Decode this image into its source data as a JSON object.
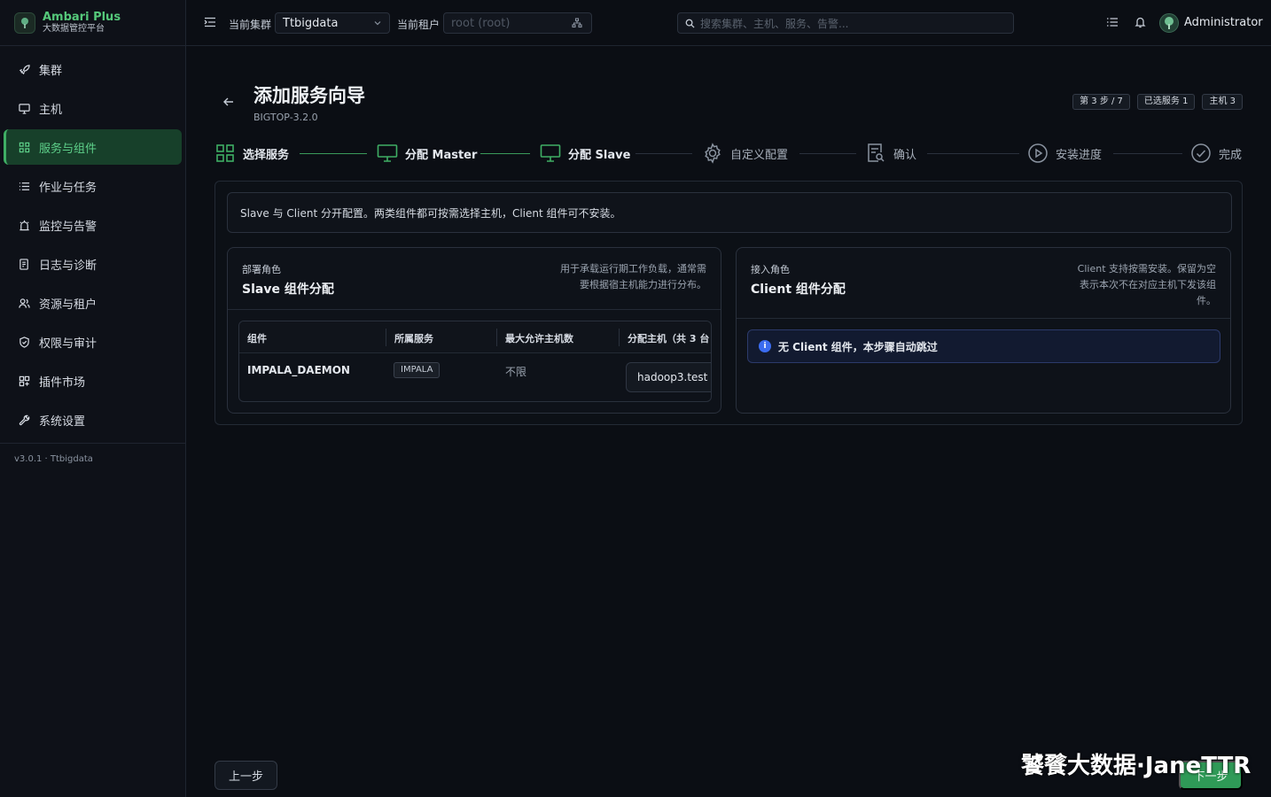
{
  "brand": {
    "name": "Ambari Plus",
    "subtitle": "大数据管控平台",
    "logo_icon": "tree-icon"
  },
  "sidebar": {
    "items": [
      {
        "label": "集群",
        "icon": "rocket-icon",
        "active": false
      },
      {
        "label": "主机",
        "icon": "monitor-icon",
        "active": false
      },
      {
        "label": "服务与组件",
        "icon": "grid-icon",
        "active": true
      },
      {
        "label": "作业与任务",
        "icon": "list-icon",
        "active": false
      },
      {
        "label": "监控与告警",
        "icon": "alarm-icon",
        "active": false
      },
      {
        "label": "日志与诊断",
        "icon": "log-icon",
        "active": false
      },
      {
        "label": "资源与租户",
        "icon": "users-icon",
        "active": false
      },
      {
        "label": "权限与审计",
        "icon": "shield-icon",
        "active": false
      },
      {
        "label": "插件市场",
        "icon": "plugin-icon",
        "active": false
      },
      {
        "label": "系统设置",
        "icon": "wrench-icon",
        "active": false
      }
    ],
    "footer": "v3.0.1 · Ttbigdata"
  },
  "topbar": {
    "cluster_label": "当前集群",
    "cluster_value": "Ttbigdata",
    "tenant_label": "当前租户",
    "tenant_placeholder": "root (root)",
    "search_placeholder": "搜索集群、主机、服务、告警...",
    "username": "Administrator"
  },
  "header": {
    "title": "添加服务向导",
    "subtitle": "BIGTOP-3.2.0",
    "chips": [
      "第 3 步 / 7",
      "已选服务 1",
      "主机 3"
    ]
  },
  "steps": [
    {
      "label": "选择服务",
      "icon": "grid-icon",
      "status": "done"
    },
    {
      "label": "分配 Master",
      "icon": "monitor-icon",
      "status": "done"
    },
    {
      "label": "分配 Slave",
      "icon": "monitor-icon",
      "status": "done"
    },
    {
      "label": "自定义配置",
      "icon": "gear-icon",
      "status": "todo"
    },
    {
      "label": "确认",
      "icon": "document-search-icon",
      "status": "todo"
    },
    {
      "label": "安装进度",
      "icon": "play-circle-icon",
      "status": "todo"
    },
    {
      "label": "完成",
      "icon": "check-circle-icon",
      "status": "todo"
    }
  ],
  "notice": "Slave 与 Client 分开配置。两类组件都可按需选择主机，Client 组件可不安装。",
  "slave_card": {
    "kicker": "部署角色",
    "title": "Slave 组件分配",
    "desc_line1": "用于承载运行期工作负载，通常需",
    "desc_line2": "要根据宿主机能力进行分布。",
    "columns": [
      "组件",
      "所属服务",
      "最大允许主机数",
      "分配主机（共 3 台"
    ],
    "rows": [
      {
        "component": "IMPALA_DAEMON",
        "service": "IMPALA",
        "max_hosts": "不限",
        "host": "hadoop3.test"
      }
    ]
  },
  "client_card": {
    "kicker": "接入角色",
    "title": "Client 组件分配",
    "desc_line1": "Client 支持按需安装。保留为空",
    "desc_line2": "表示本次不在对应主机下发该组",
    "desc_line3": "件。",
    "info": "无 Client 组件，本步骤自动跳过"
  },
  "footer": {
    "prev_label": "上一步",
    "next_label": "下一步"
  },
  "watermark": "饕餮大数据·JaneTTR",
  "colors": {
    "accent": "#3fae64",
    "info": "#3b6cf0",
    "background": "#0b0e14"
  }
}
